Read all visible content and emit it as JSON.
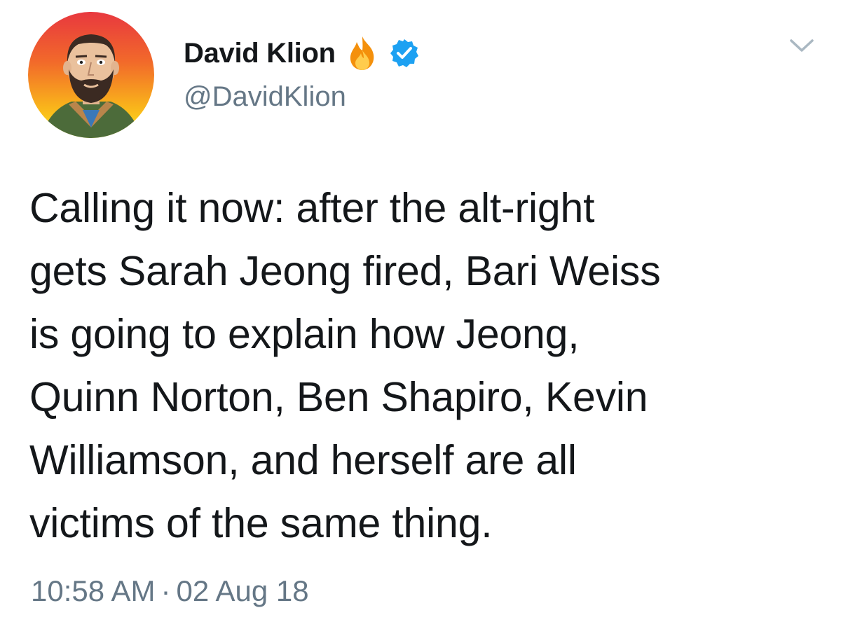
{
  "author": {
    "display_name": "David Klion",
    "handle": "@DavidKlion",
    "name_emoji": "fire-icon",
    "verified_badge": "verified-icon",
    "avatar": "cartoon-avatar"
  },
  "menu": {
    "icon": "chevron-down-icon"
  },
  "tweet": {
    "lines": [
      "Calling it now: after the alt-right",
      "gets Sarah Jeong fired, Bari Weiss",
      "is going to explain how Jeong,",
      "Quinn Norton, Ben Shapiro, Kevin",
      "Williamson, and herself are all",
      "victims of the same thing."
    ],
    "time": "10:58 AM",
    "separator": "·",
    "date": "02 Aug 18"
  },
  "colors": {
    "text": "#14171a",
    "secondary": "#657786",
    "verified": "#1da1f2",
    "background": "#ffffff"
  }
}
